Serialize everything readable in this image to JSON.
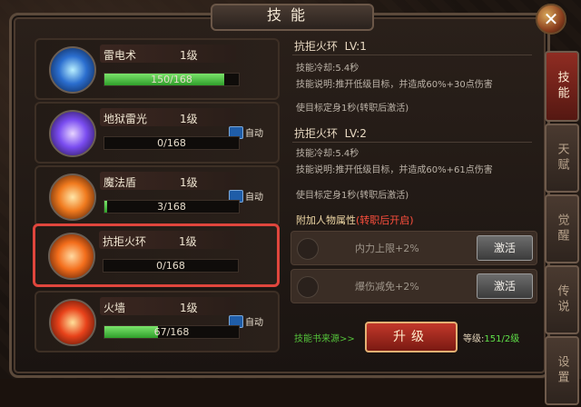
{
  "header": {
    "title": "技能"
  },
  "skills": [
    {
      "name": "雷电术",
      "level": "1级",
      "progress": "150/168",
      "fill": 0.89,
      "auto": false
    },
    {
      "name": "地狱雷光",
      "level": "1级",
      "progress": "0/168",
      "fill": 0.0,
      "auto": true,
      "auto_label": "自动"
    },
    {
      "name": "魔法盾",
      "level": "1级",
      "progress": "3/168",
      "fill": 0.018,
      "auto": true,
      "auto_label": "自动"
    },
    {
      "name": "抗拒火环",
      "level": "1级",
      "progress": "0/168",
      "fill": 0.0,
      "auto": false
    },
    {
      "name": "火墙",
      "level": "1级",
      "progress": "67/168",
      "fill": 0.4,
      "auto": true,
      "auto_label": "自动"
    }
  ],
  "detail": {
    "lv1": {
      "title": "抗拒火环",
      "level": "LV:1",
      "cooldown": "技能冷却:5.4秒",
      "desc": "技能说明:推开低级目标，并造成60%+30点伤害",
      "desc2": "使目标定身1秒(转职后激活)"
    },
    "lv2": {
      "title": "抗拒火环",
      "level": "LV:2",
      "cooldown": "技能冷却:5.4秒",
      "desc": "技能说明:推开低级目标，并造成60%+61点伤害",
      "desc2": "使目标定身1秒(转职后激活)"
    },
    "attr": {
      "title": "附加人物属性",
      "title_red": "(转职后开启)",
      "rows": [
        {
          "label": "内力上限+2%",
          "button": "激活"
        },
        {
          "label": "爆伤减免+2%",
          "button": "激活"
        }
      ]
    },
    "footer": {
      "source": "技能书来源>>",
      "upgrade": "升级",
      "level_label": "等级:",
      "level_value": "151/2级"
    }
  },
  "tabs": [
    "技能",
    "天赋",
    "觉醒",
    "传说",
    "设置"
  ]
}
